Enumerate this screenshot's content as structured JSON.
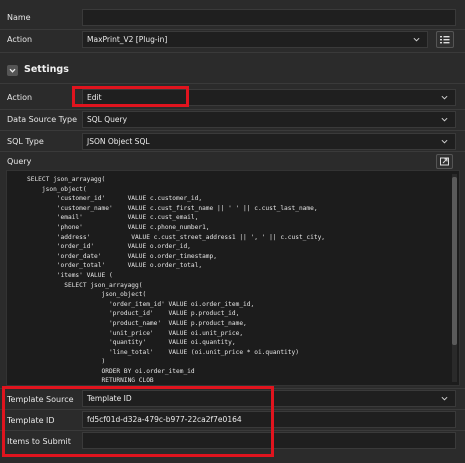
{
  "fields": {
    "name": {
      "label": "Name",
      "value": ""
    },
    "action_top": {
      "label": "Action",
      "value": "MaxPrint_V2 [Plug-in]"
    },
    "settings": {
      "title": "Settings"
    },
    "action": {
      "label": "Action",
      "value": "Edit"
    },
    "data_source_type": {
      "label": "Data Source Type",
      "value": "SQL Query"
    },
    "sql_type": {
      "label": "SQL Type",
      "value": "JSON Object SQL"
    },
    "query": {
      "label": "Query"
    },
    "template_source": {
      "label": "Template Source",
      "value": "Template ID"
    },
    "template_id": {
      "label": "Template ID",
      "value": "fd5cf01d-d32a-479c-b977-22ca2f7e0164"
    },
    "items_to_submit": {
      "label": "Items to Submit",
      "value": ""
    }
  },
  "query_code": "SELECT json_arrayagg(\n    json_object(\n        'customer_id'      VALUE c.customer_id,\n        'customer_name'    VALUE c.cust_first_name || ' ' || c.cust_last_name,\n        'email'            VALUE c.cust_email,\n        'phone'            VALUE c.phone_number1,\n        'address'           VALUE c.cust_street_address1 || ', ' || c.cust_city,\n        'order_id'         VALUE o.order_id,\n        'order_date'       VALUE o.order_timestamp,\n        'order_total'      VALUE o.order_total,\n        'items' VALUE (\n          SELECT json_arrayagg(\n                    json_object(\n                      'order_item_id' VALUE oi.order_item_id,\n                      'product_id'    VALUE p.product_id,\n                      'product_name'  VALUE p.product_name,\n                      'unit_price'    VALUE oi.unit_price,\n                      'quantity'      VALUE oi.quantity,\n                      'line_total'    VALUE (oi.unit_price * oi.quantity)\n                    )\n                    ORDER BY oi.order_item_id\n                    RETURNING CLOB\n                  )",
  "icons": {
    "list_button": "list-icon",
    "expand_button": "expand-icon",
    "chevron": "chevron-down-icon",
    "collapse": "collapse-icon"
  },
  "colors": {
    "highlight": "#e0141e",
    "background": "#2b2b2b",
    "field": "#1f1f1f"
  }
}
